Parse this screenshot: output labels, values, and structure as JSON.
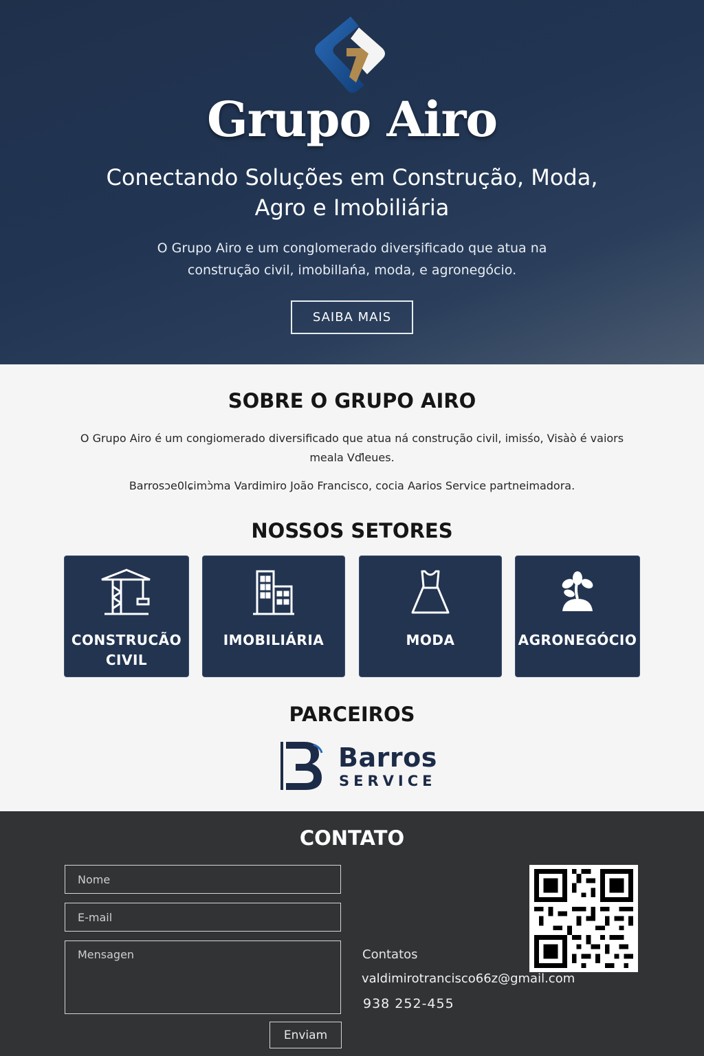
{
  "hero": {
    "brand": "Grupo Airo",
    "tagline": "Conectando Soluções em Construção, Moda, Agro e Imobiliária",
    "description": "O Grupo Airo e um conglomerado diverşificado que atua na construção civil, imobillańa, moda, e agronegócio.",
    "cta_label": "SAIBA MAIS",
    "colors": {
      "background": "#213553",
      "logo_blue": "#1d4f8f",
      "logo_gold": "#b08a4e"
    }
  },
  "about": {
    "title": "SOBRE O GRUPO AIRO",
    "paragraph1": "O Grupo Airo é um congiomerado diversificado que atua ná construção civil, imisśo, Visàò é vaiors meala Vďleues.",
    "paragraph2": "Barrosɔe0lɕimɔ̀ma Vardimiro João Francisco, cocia Aarios Service partneimadora."
  },
  "sectors": {
    "title": "NOSSOS SETORES",
    "items": [
      {
        "label": "CONSTRUCÃO CIVIL",
        "icon": "crane-icon"
      },
      {
        "label": "IMOBILIÁRIA",
        "icon": "building-icon"
      },
      {
        "label": "MODA",
        "icon": "dress-icon"
      },
      {
        "label": "AGRONEGÓCIO",
        "icon": "plant-icon"
      }
    ],
    "card_color": "#223450"
  },
  "partners": {
    "title": "PARCEIROS",
    "logo_name": "Barros",
    "logo_sub": "SERVICE",
    "logo_color": "#1c2b48"
  },
  "contact": {
    "title": "CONTATO",
    "name_placeholder": "Nome",
    "email_placeholder": "E-mail",
    "message_placeholder": "Mensagen",
    "send_label": "Enviam",
    "label": "Contatos",
    "email": "valdimirotrancisco66z@gmail.com",
    "phone": "938 252-455",
    "qr_icon": "qr-code-icon",
    "background": "#323335"
  }
}
